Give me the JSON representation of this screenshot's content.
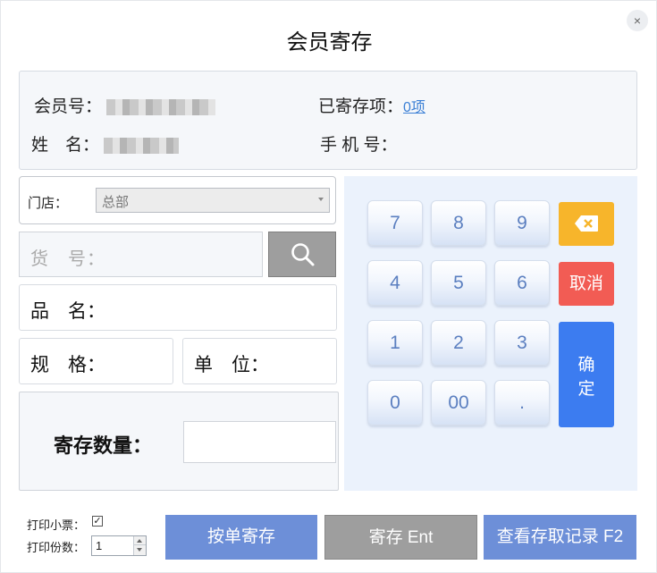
{
  "dialog": {
    "title": "会员寄存",
    "close_icon": "×"
  },
  "member": {
    "id_label": "会员号：",
    "stored_label": "已寄存项：",
    "stored_value": "0项",
    "name_label": "姓　名：",
    "phone_label": "手 机 号："
  },
  "form": {
    "store_label": "门店：",
    "store_value": "总部",
    "sku_label": "货　号：",
    "product_name_label": "品　名：",
    "spec_label": "规　格：",
    "unit_label": "单　位：",
    "quantity_label": "寄存数量：",
    "quantity_value": ""
  },
  "keypad": {
    "keys": [
      "7",
      "8",
      "9",
      "4",
      "5",
      "6",
      "1",
      "2",
      "3",
      "0",
      "00",
      "."
    ],
    "cancel_label": "取消",
    "confirm_line1": "确",
    "confirm_line2": "定",
    "backspace_color": "#f7b52b",
    "cancel_color": "#f25c54",
    "confirm_color": "#3c7cf0"
  },
  "print": {
    "receipt_label": "打印小票：",
    "receipt_checked": true,
    "copies_label": "打印份数：",
    "copies_value": "1"
  },
  "actions": {
    "by_order_label": "按单寄存",
    "deposit_label": "寄存 Ent",
    "history_label": "查看存取记录 F2",
    "colors": {
      "by_order": "#6d8fd8",
      "deposit": "#9e9e9e",
      "history": "#6d8fd8"
    }
  }
}
